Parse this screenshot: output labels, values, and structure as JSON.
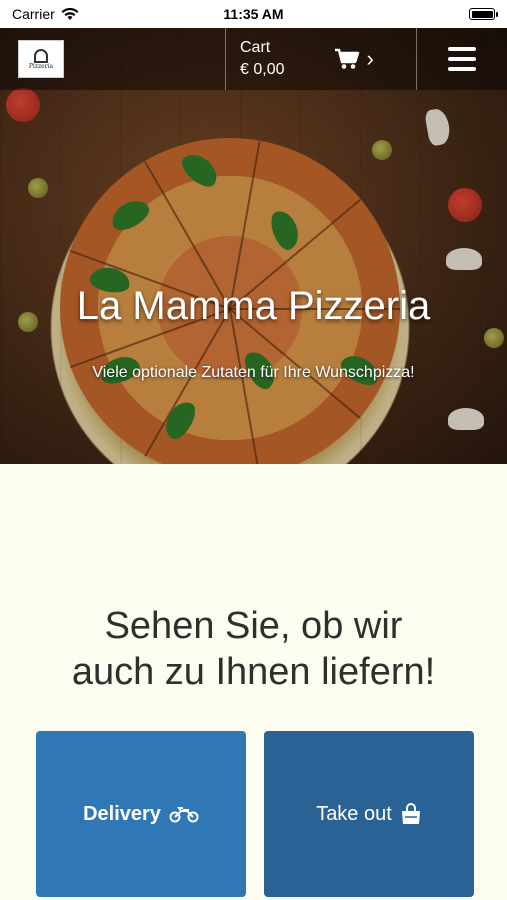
{
  "status_bar": {
    "carrier": "Carrier",
    "time": "11:35 AM"
  },
  "header": {
    "logo_text": "Pizzeria",
    "cart_label": "Cart",
    "cart_total": "€ 0,00",
    "cart_chevron": "›",
    "cart_icon": "shopping-cart-icon",
    "menu_icon": "hamburger-menu-icon"
  },
  "hero": {
    "title": "La Mamma Pizzeria",
    "subtitle": "Viele optionale Zutaten für Ihre Wunschpizza!"
  },
  "delivery_check": {
    "title_line1": "Sehen Sie, ob wir",
    "title_line2": "auch zu Ihnen liefern!"
  },
  "order_options": {
    "delivery_label": "Delivery",
    "delivery_icon": "motorcycle-icon",
    "takeout_label": "Take out",
    "takeout_icon": "shopping-bag-icon"
  },
  "colors": {
    "delivery_button": "#2f77b5",
    "takeout_button": "#2a6296",
    "page_background": "#fdfcf1"
  }
}
